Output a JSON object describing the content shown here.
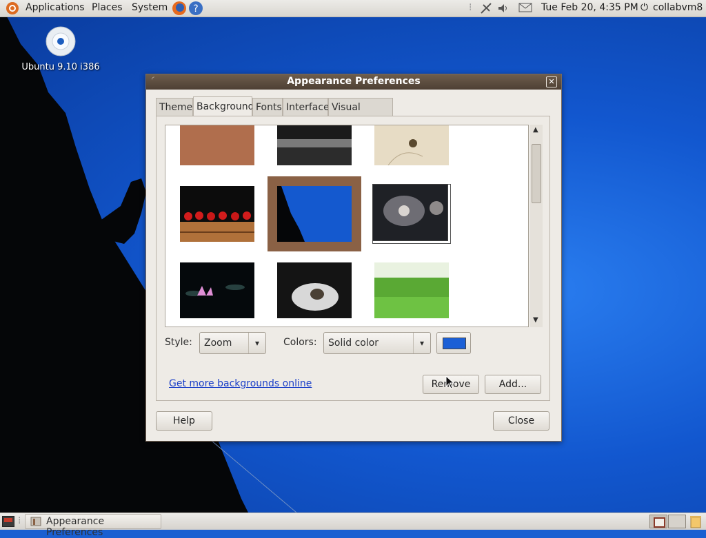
{
  "top_panel": {
    "menus": [
      "Applications",
      "Places",
      "System"
    ],
    "datetime": "Tue Feb 20,  4:35 PM",
    "user": "collabvm8"
  },
  "desktop": {
    "icon_label": "Ubuntu 9.10 i386"
  },
  "dialog": {
    "title": "Appearance Preferences",
    "tabs": [
      {
        "label": "Theme",
        "active": false
      },
      {
        "label": "Background",
        "active": true
      },
      {
        "label": "Fonts",
        "active": false
      },
      {
        "label": "Interface",
        "active": false
      },
      {
        "label": "Visual Effects",
        "active": false
      }
    ],
    "style_label": "Style:",
    "style_value": "Zoom",
    "colors_label": "Colors:",
    "colors_value": "Solid color",
    "color_swatch": "#1b5fd6",
    "link_text": "Get more backgrounds online",
    "remove_button": "Remove",
    "add_button": "Add...",
    "help_button": "Help",
    "close_button": "Close"
  },
  "taskbar": {
    "window_label": "Appearance Preferences"
  },
  "colors": {
    "selected_frame": "#8a6145",
    "title_bar": "#5b4b3d"
  }
}
